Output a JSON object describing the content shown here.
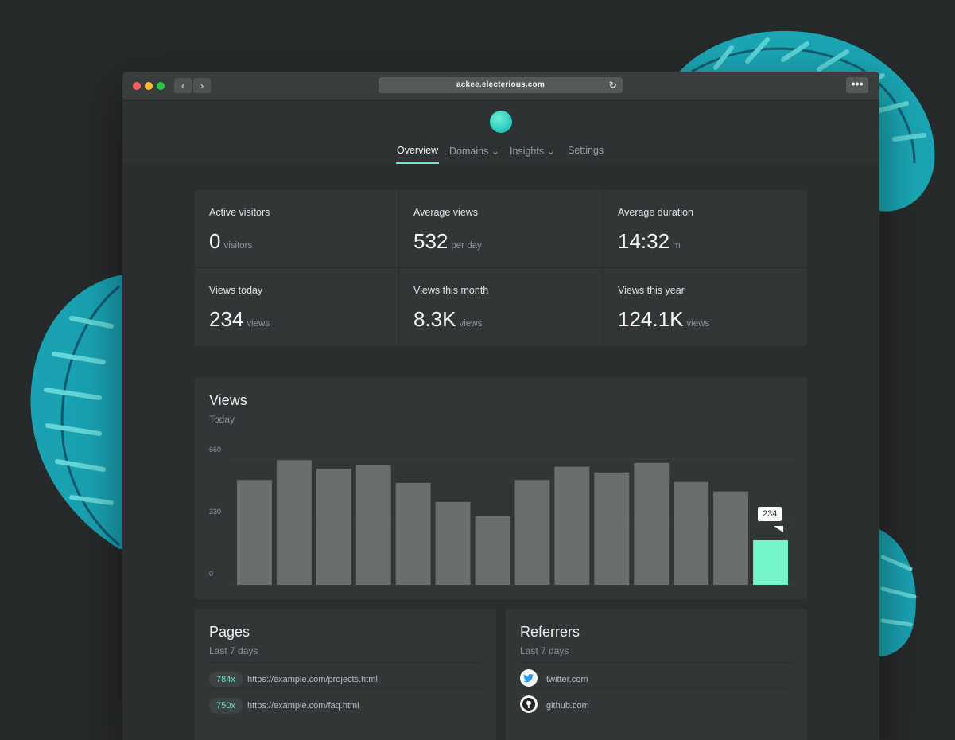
{
  "browser": {
    "url": "ackee.electerious.com",
    "nav_back": "‹",
    "nav_forward": "›",
    "reload_icon": "↻",
    "menu_icon": "•••"
  },
  "nav": {
    "items": [
      {
        "label": "Overview",
        "active": true
      },
      {
        "label": "Domains ⌄",
        "active": false
      },
      {
        "label": "Insights ⌄",
        "active": false
      },
      {
        "label": "Settings",
        "active": false
      }
    ]
  },
  "stats": [
    {
      "label": "Active visitors",
      "value": "0",
      "unit": "visitors"
    },
    {
      "label": "Average views",
      "value": "532",
      "unit": "per day"
    },
    {
      "label": "Average duration",
      "value": "14:32",
      "unit": "m"
    },
    {
      "label": "Views today",
      "value": "234",
      "unit": "views"
    },
    {
      "label": "Views this month",
      "value": "8.3K",
      "unit": "views"
    },
    {
      "label": "Views this year",
      "value": "124.1K",
      "unit": "views"
    }
  ],
  "views": {
    "title": "Views",
    "subtitle": "Today"
  },
  "chart_data": {
    "type": "bar",
    "title": "Views",
    "subtitle": "Today",
    "y_ticks": [
      "660",
      "330",
      "0"
    ],
    "ylim": [
      0,
      660
    ],
    "values": [
      550,
      655,
      610,
      630,
      535,
      435,
      360,
      550,
      620,
      590,
      640,
      540,
      490,
      234
    ],
    "highlight_index": 13,
    "highlight_label": "234",
    "bar_color": "#6a6e6d",
    "highlight_color": "#74f6c8",
    "grid": true
  },
  "pages": {
    "title": "Pages",
    "subtitle": "Last 7 days",
    "rows": [
      {
        "count": "784x",
        "url": "https://example.com/projects.html"
      },
      {
        "count": "750x",
        "url": "https://example.com/faq.html"
      }
    ]
  },
  "referrers": {
    "title": "Referrers",
    "subtitle": "Last 7 days",
    "rows": [
      {
        "icon": "twitter-icon",
        "name": "twitter.com"
      },
      {
        "icon": "github-icon",
        "name": "github.com"
      }
    ]
  },
  "colors": {
    "accent": "#6fe8c6",
    "background": "#272a2b",
    "card": "#323637"
  }
}
